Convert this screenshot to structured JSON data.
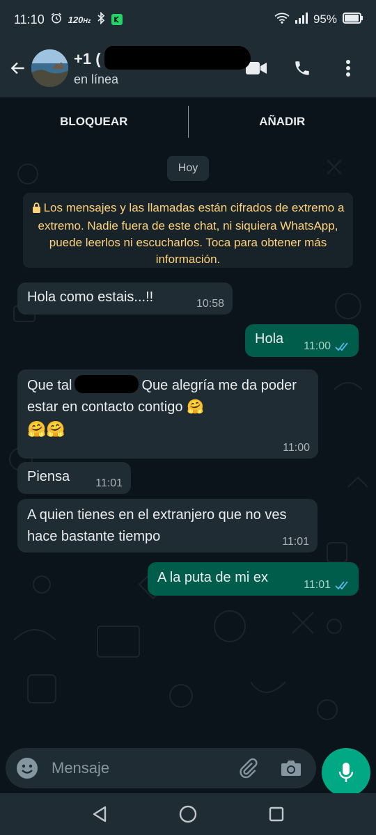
{
  "status_bar": {
    "time": "11:10",
    "refresh": "120",
    "refresh_unit": "Hz",
    "battery": "95%"
  },
  "header": {
    "contact_name_visible": "+1 (",
    "contact_status": "en línea",
    "icons": [
      "back-arrow-icon",
      "video-call-icon",
      "phone-icon",
      "more-vert-icon"
    ]
  },
  "block_bar": {
    "block_label": "BLOQUEAR",
    "add_label": "AÑADIR"
  },
  "date_chip": "Hoy",
  "encryption_notice": "Los mensajes y las llamadas están cifrados de extremo a extremo. Nadie fuera de este chat, ni siquiera WhatsApp, puede leerlos ni escucharlos. Toca para obtener más información.",
  "messages": [
    {
      "direction": "in",
      "text": "Hola como estais...!!",
      "time": "10:58"
    },
    {
      "direction": "out",
      "text": "Hola",
      "time": "11:00",
      "status": "read"
    },
    {
      "direction": "in",
      "text_before": "Que tal",
      "text_after": "Que alegría me da poder estar en contacto contigo 🤗",
      "text_line3": "🤗🤗",
      "time": "11:00"
    },
    {
      "direction": "in",
      "text": "Piensa",
      "time": "11:01"
    },
    {
      "direction": "in",
      "text": "A quien tienes en el extranjero que no ves hace bastante tiempo",
      "time": "11:01"
    },
    {
      "direction": "out",
      "text": "A la puta de mi ex",
      "time": "11:01",
      "status": "read"
    }
  ],
  "composer": {
    "placeholder": "Mensaje"
  },
  "colors": {
    "accent": "#00a884",
    "outgoing_bubble": "#005c4b",
    "incoming_bubble": "#202c33",
    "header_bg": "#1f2c34",
    "chat_bg": "#0b141a",
    "read_ticks": "#53bdeb"
  }
}
